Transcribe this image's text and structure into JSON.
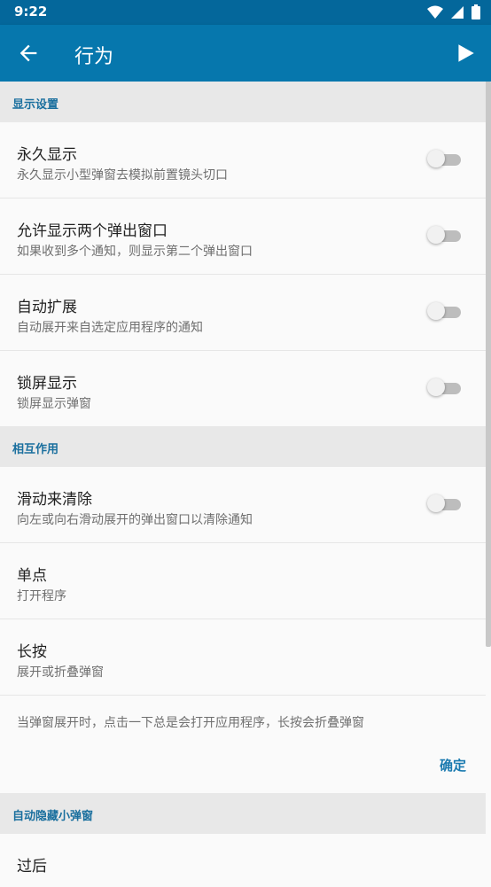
{
  "status_bar": {
    "time": "9:22",
    "icons": [
      "wifi-icon",
      "signal-icon",
      "battery-icon"
    ]
  },
  "app_bar": {
    "title": "行为",
    "back_icon": "arrow-back-icon",
    "action_icon": "play-icon"
  },
  "colors": {
    "primary": "#0677ad",
    "primary_dark": "#04679b",
    "section_header_bg": "#e8e8e8",
    "section_header_text": "#1a6f9e",
    "accent_text": "#1a7ab0"
  },
  "sections": [
    {
      "header": "显示设置",
      "items": [
        {
          "title": "永久显示",
          "subtitle": "永久显示小型弹窗去模拟前置镜头切口",
          "toggle": false
        },
        {
          "title": "允许显示两个弹出窗口",
          "subtitle": "如果收到多个通知，则显示第二个弹出窗口",
          "toggle": false
        },
        {
          "title": "自动扩展",
          "subtitle": "自动展开来自选定应用程序的通知",
          "toggle": false
        },
        {
          "title": "锁屏显示",
          "subtitle": "锁屏显示弹窗",
          "toggle": false
        }
      ]
    },
    {
      "header": "相互作用",
      "items": [
        {
          "title": "滑动来清除",
          "subtitle": "向左或向右滑动展开的弹出窗口以清除通知",
          "toggle": false
        },
        {
          "title": "单点",
          "subtitle": "打开程序"
        },
        {
          "title": "长按",
          "subtitle": "展开或折叠弹窗"
        }
      ],
      "note": "当弹窗展开时，点击一下总是会打开应用程序，长按会折叠弹窗",
      "confirm_label": "确定"
    },
    {
      "header": "自动隐藏小弹窗",
      "items": [
        {
          "title": "过后"
        }
      ]
    }
  ]
}
